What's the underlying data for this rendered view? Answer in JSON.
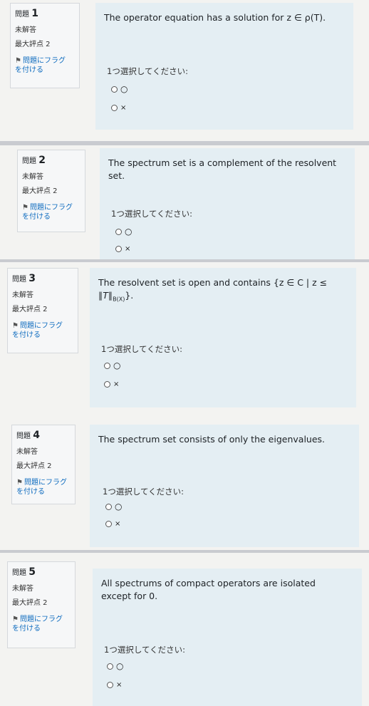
{
  "common": {
    "state": "未解答",
    "grade": "最大評点 2",
    "flag_line1": "問題にフラグ",
    "flag_line2": "を付ける",
    "prompt": "1つ選択してください:",
    "option_a": "○",
    "option_b": "×",
    "question_label": "問題",
    "flag_icon": "flag-icon"
  },
  "questions": [
    {
      "number": "1",
      "text": "The operator equation has a solution for z ∈ ρ(T)."
    },
    {
      "number": "2",
      "text": "The spectrum set is a complement of the resolvent set."
    },
    {
      "number": "3",
      "text_main": "The resolvent set is open and contains {z ∈ C | z ≤",
      "text_cont": "∥T∥",
      "text_sub": "B(X)",
      "text_end": "}."
    },
    {
      "number": "4",
      "text": "The spectrum set consists of only the eigenvalues."
    },
    {
      "number": "5",
      "text": "All spectrums of compact operators are isolated except for 0."
    }
  ]
}
